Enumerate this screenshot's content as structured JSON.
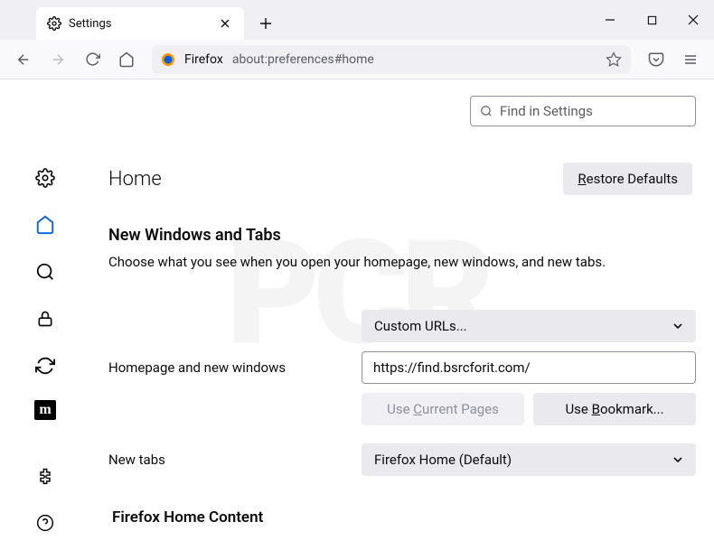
{
  "tab": {
    "title": "Settings"
  },
  "urlbar": {
    "label": "Firefox",
    "path": "about:preferences#home"
  },
  "search": {
    "placeholder": "Find in Settings"
  },
  "page": {
    "title": "Home",
    "restore": "Restore Defaults"
  },
  "section": {
    "new_windows_title": "New Windows and Tabs",
    "new_windows_desc": "Choose what you see when you open your homepage, new windows, and new tabs.",
    "home_content_title": "Firefox Home Content"
  },
  "homepage": {
    "label": "Homepage and new windows",
    "mode": "Custom URLs...",
    "url": "https://find.bsrcforit.com/",
    "use_current": "Use Current Pages",
    "use_bookmark": "Use Bookmark..."
  },
  "newtabs": {
    "label": "New tabs",
    "mode": "Firefox Home (Default)"
  },
  "sidebar_ext": {
    "label": "m"
  }
}
